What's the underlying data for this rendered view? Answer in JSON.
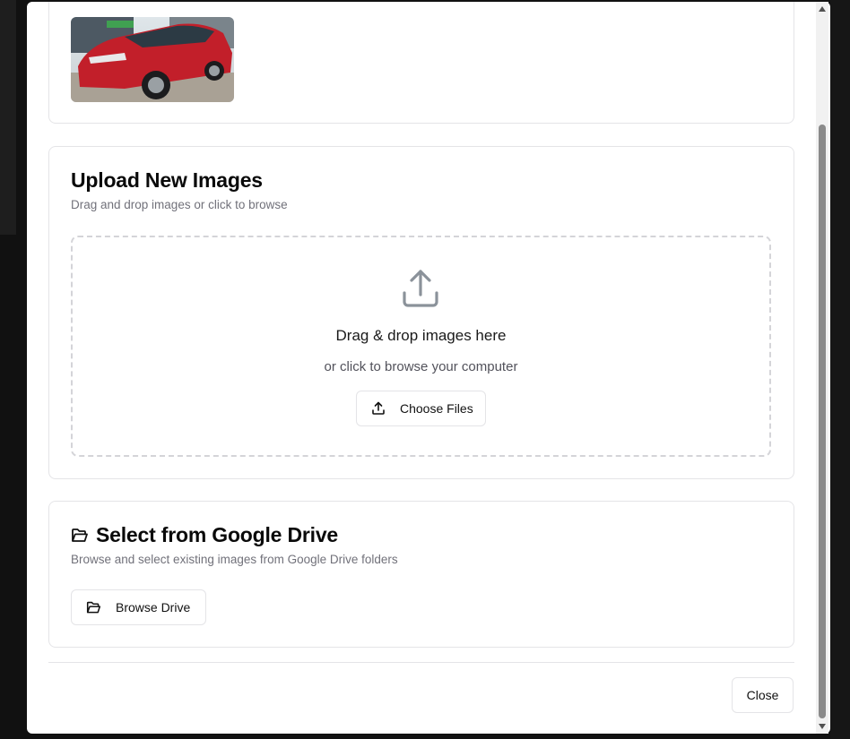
{
  "existing_images": {
    "thumbnail_alt": "red sedan"
  },
  "upload": {
    "title": "Upload New Images",
    "subtitle": "Drag and drop images or click to browse",
    "dropzone_title": "Drag & drop images here",
    "dropzone_subtitle": "or click to browse your computer",
    "choose_files_label": "Choose Files",
    "upload_icon": "upload-icon"
  },
  "drive": {
    "title": "Select from Google Drive",
    "subtitle": "Browse and select existing images from Google Drive folders",
    "browse_label": "Browse Drive",
    "folder_icon": "folder-open-icon"
  },
  "footer": {
    "close_label": "Close"
  },
  "colors": {
    "border": "#e4e4e7",
    "muted_text": "#71717a",
    "icon_gray": "#9ca3af"
  }
}
